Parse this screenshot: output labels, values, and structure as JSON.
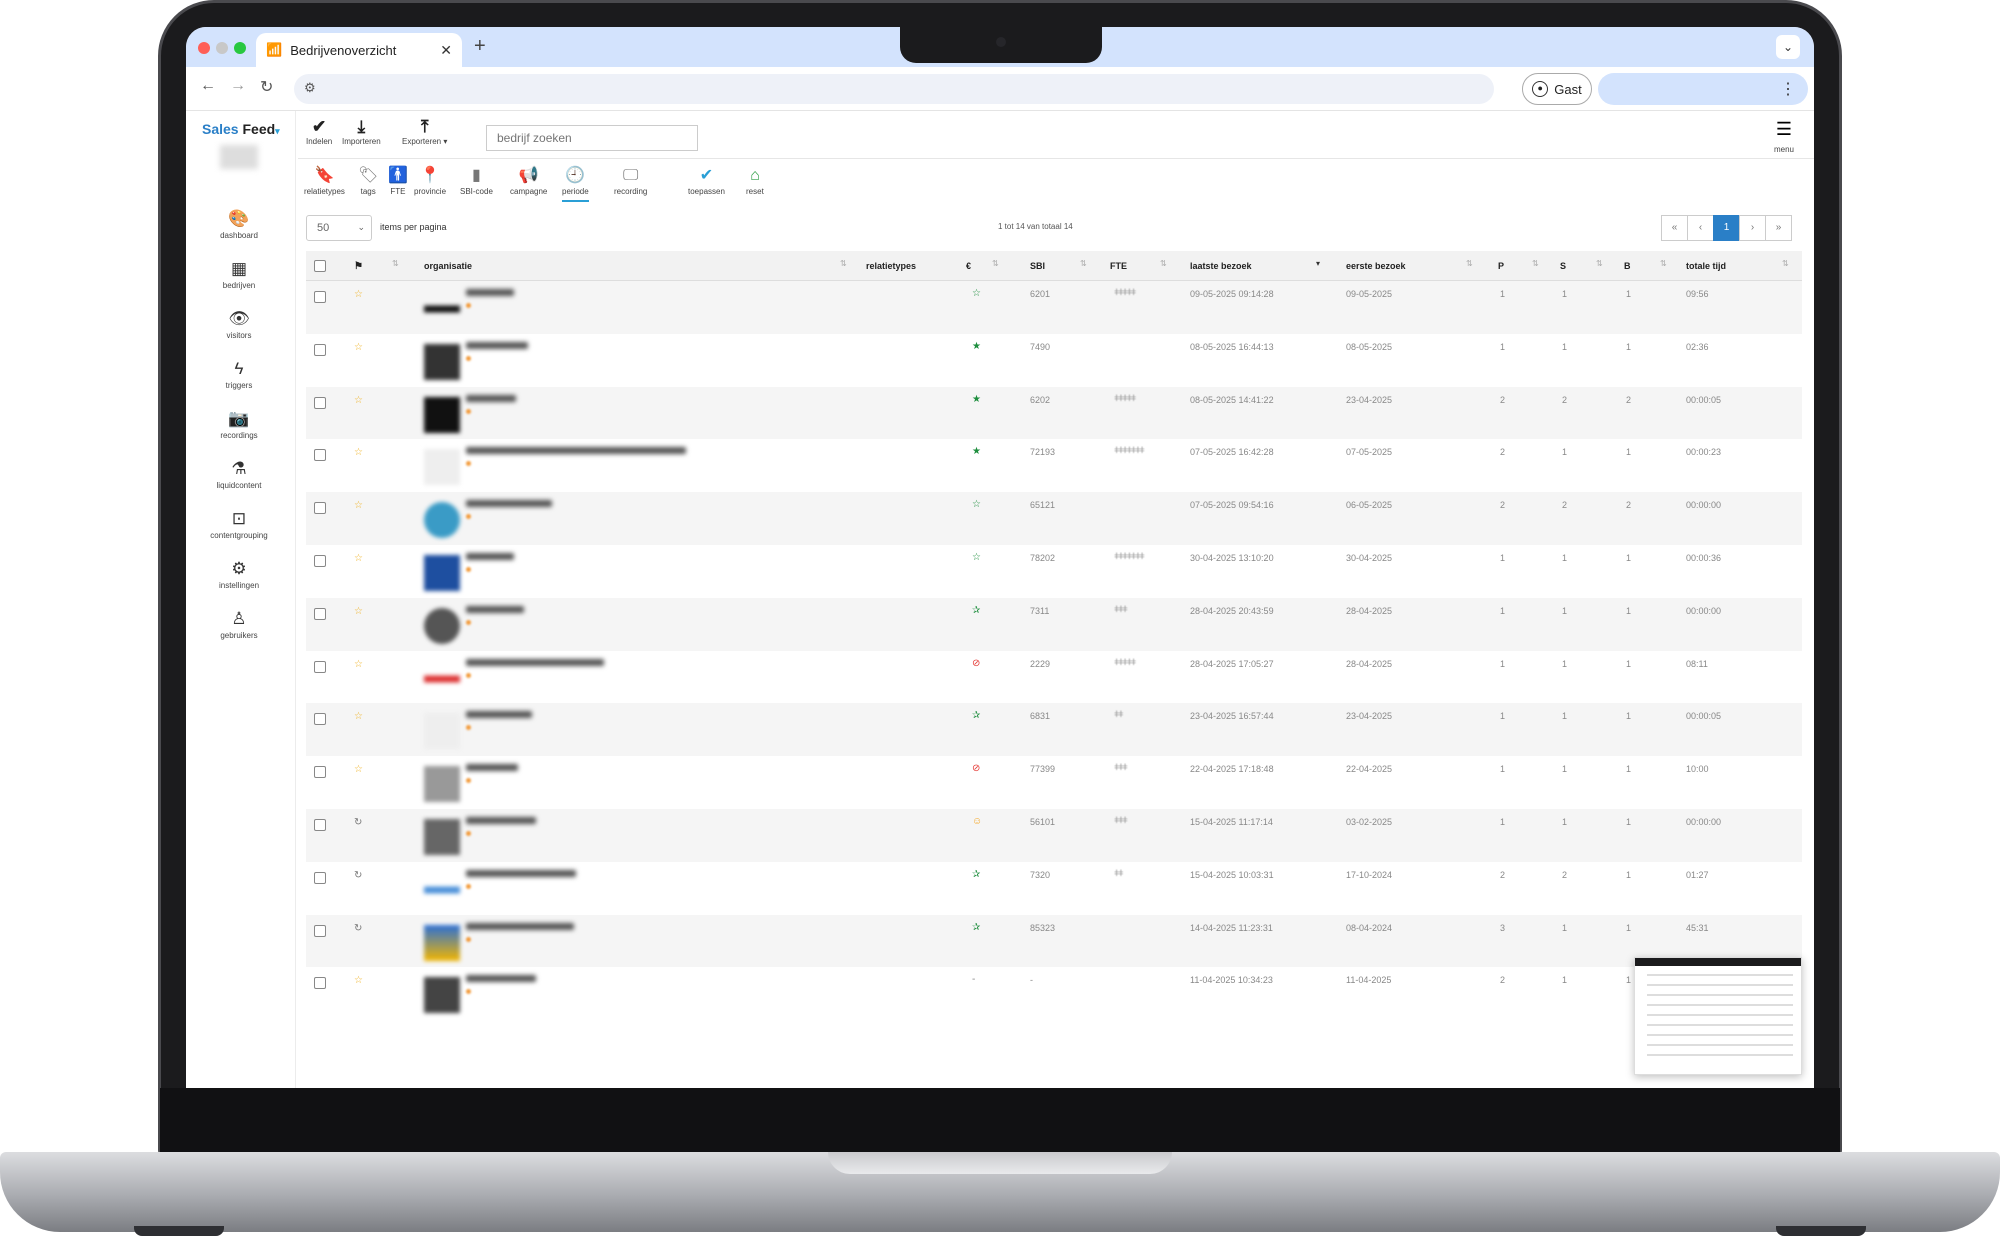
{
  "browser": {
    "tab_title": "Bedrijvenoverzicht",
    "profile_label": "Gast"
  },
  "sidebar": {
    "logo_part1": "Sales",
    "logo_part2": "Feed",
    "items": [
      {
        "label": "dashboard",
        "icon": "palette-icon"
      },
      {
        "label": "bedrijven",
        "icon": "building-icon"
      },
      {
        "label": "visitors",
        "icon": "eye-icon"
      },
      {
        "label": "triggers",
        "icon": "bolt-icon"
      },
      {
        "label": "recordings",
        "icon": "camera-icon"
      },
      {
        "label": "liquidcontent",
        "icon": "flask-icon"
      },
      {
        "label": "contentgrouping",
        "icon": "group-icon"
      },
      {
        "label": "instellingen",
        "icon": "gear-icon"
      },
      {
        "label": "gebruikers",
        "icon": "user-icon"
      }
    ]
  },
  "actions": {
    "indelen": "Indelen",
    "importeren": "Importeren",
    "exporteren": "Exporteren",
    "search_placeholder": "bedrijf zoeken",
    "menu": "menu"
  },
  "filters": [
    {
      "label": "relatietypes"
    },
    {
      "label": "tags"
    },
    {
      "label": "FTE"
    },
    {
      "label": "provincie"
    },
    {
      "label": "SBI-code"
    },
    {
      "label": "campagne"
    },
    {
      "label": "periode"
    },
    {
      "label": "recording"
    },
    {
      "label": "toepassen"
    },
    {
      "label": "reset"
    }
  ],
  "pagination": {
    "per_page": "50",
    "per_page_label": "items per pagina",
    "range_text": "1 tot 14 van totaal 14",
    "first": "«",
    "prev": "‹",
    "current": "1",
    "next": "›",
    "last": "»"
  },
  "table": {
    "columns": {
      "organisatie": "organisatie",
      "relatietypes": "relatietypes",
      "euro": "€",
      "sbi": "SBI",
      "fte": "FTE",
      "laatste_bezoek": "laatste bezoek",
      "eerste_bezoek": "eerste bezoek",
      "p": "P",
      "s": "S",
      "b": "B",
      "totale_tijd": "totale tijd"
    },
    "rows": [
      {
        "flag": "☆",
        "rel": "☆",
        "sbi": "6201",
        "fte": "ǂǂǂǂǂ",
        "laatste": "09-05-2025 09:14:28",
        "eerste": "09-05-2025",
        "p": "1",
        "s": "1",
        "b": "1",
        "tijd": "09:56"
      },
      {
        "flag": "☆",
        "rel": "★",
        "sbi": "7490",
        "fte": "",
        "laatste": "08-05-2025 16:44:13",
        "eerste": "08-05-2025",
        "p": "1",
        "s": "1",
        "b": "1",
        "tijd": "02:36"
      },
      {
        "flag": "☆",
        "rel": "★",
        "sbi": "6202",
        "fte": "ǂǂǂǂǂ",
        "laatste": "08-05-2025 14:41:22",
        "eerste": "23-04-2025",
        "p": "2",
        "s": "2",
        "b": "2",
        "tijd": "00:00:05"
      },
      {
        "flag": "☆",
        "rel": "★",
        "sbi": "72193",
        "fte": "ǂǂǂǂǂǂǂ",
        "laatste": "07-05-2025 16:42:28",
        "eerste": "07-05-2025",
        "p": "2",
        "s": "1",
        "b": "1",
        "tijd": "00:00:23"
      },
      {
        "flag": "☆",
        "rel": "☆",
        "sbi": "65121",
        "fte": "",
        "laatste": "07-05-2025 09:54:16",
        "eerste": "06-05-2025",
        "p": "2",
        "s": "2",
        "b": "2",
        "tijd": "00:00:00"
      },
      {
        "flag": "☆",
        "rel": "☆",
        "sbi": "78202",
        "fte": "ǂǂǂǂǂǂǂ",
        "laatste": "30-04-2025 13:10:20",
        "eerste": "30-04-2025",
        "p": "1",
        "s": "1",
        "b": "1",
        "tijd": "00:00:36"
      },
      {
        "flag": "☆",
        "rel": "✰",
        "sbi": "7311",
        "fte": "ǂǂǂ",
        "laatste": "28-04-2025 20:43:59",
        "eerste": "28-04-2025",
        "p": "1",
        "s": "1",
        "b": "1",
        "tijd": "00:00:00"
      },
      {
        "flag": "☆",
        "rel": "⊘",
        "sbi": "2229",
        "fte": "ǂǂǂǂǂ",
        "laatste": "28-04-2025 17:05:27",
        "eerste": "28-04-2025",
        "p": "1",
        "s": "1",
        "b": "1",
        "tijd": "08:11"
      },
      {
        "flag": "☆",
        "rel": "✰",
        "sbi": "6831",
        "fte": "ǂǂ",
        "laatste": "23-04-2025 16:57:44",
        "eerste": "23-04-2025",
        "p": "1",
        "s": "1",
        "b": "1",
        "tijd": "00:00:05"
      },
      {
        "flag": "☆",
        "rel": "⊘",
        "sbi": "77399",
        "fte": "ǂǂǂ",
        "laatste": "22-04-2025 17:18:48",
        "eerste": "22-04-2025",
        "p": "1",
        "s": "1",
        "b": "1",
        "tijd": "10:00"
      },
      {
        "flag": "↻",
        "rel": "☺",
        "sbi": "56101",
        "fte": "ǂǂǂ",
        "laatste": "15-04-2025 11:17:14",
        "eerste": "03-02-2025",
        "p": "1",
        "s": "1",
        "b": "1",
        "tijd": "00:00:00"
      },
      {
        "flag": "↻",
        "rel": "✰",
        "sbi": "7320",
        "fte": "ǂǂ",
        "laatste": "15-04-2025 10:03:31",
        "eerste": "17-10-2024",
        "p": "2",
        "s": "2",
        "b": "1",
        "tijd": "01:27"
      },
      {
        "flag": "↻",
        "rel": "✰",
        "sbi": "85323",
        "fte": "",
        "laatste": "14-04-2025 11:23:31",
        "eerste": "08-04-2024",
        "p": "3",
        "s": "1",
        "b": "1",
        "tijd": "45:31"
      },
      {
        "flag": "☆",
        "rel": "-",
        "sbi": "-",
        "fte": "",
        "laatste": "11-04-2025 10:34:23",
        "eerste": "11-04-2025",
        "p": "2",
        "s": "1",
        "b": "1",
        "tijd": ""
      }
    ]
  },
  "colors": {
    "accent": "#2a7fc7",
    "flag_star": "#f0b429",
    "rel_green": "#1e8e3e",
    "rel_red": "#e53935",
    "rel_orange": "#f5a623"
  }
}
